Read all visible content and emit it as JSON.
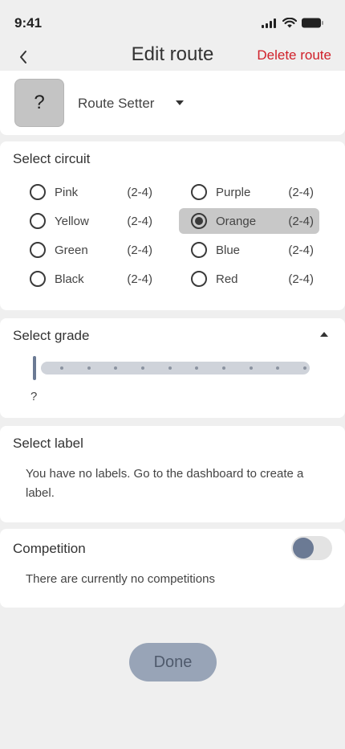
{
  "status_bar": {
    "time": "9:41"
  },
  "nav": {
    "title": "Edit route",
    "delete_label": "Delete route"
  },
  "setter": {
    "avatar_text": "?",
    "name": "Route Setter"
  },
  "circuit": {
    "title": "Select circuit",
    "options": [
      {
        "label": "Pink",
        "count": "(2-4)",
        "selected": false
      },
      {
        "label": "Purple",
        "count": "(2-4)",
        "selected": false
      },
      {
        "label": "Yellow",
        "count": "(2-4)",
        "selected": false
      },
      {
        "label": "Orange",
        "count": "(2-4)",
        "selected": true
      },
      {
        "label": "Green",
        "count": "(2-4)",
        "selected": false
      },
      {
        "label": "Blue",
        "count": "(2-4)",
        "selected": false
      },
      {
        "label": "Black",
        "count": "(2-4)",
        "selected": false
      },
      {
        "label": "Red",
        "count": "(2-4)",
        "selected": false
      }
    ]
  },
  "grade": {
    "title": "Select grade",
    "value": "?",
    "slider_fraction": 0
  },
  "label": {
    "title": "Select label",
    "empty_text": "You have no labels. Go to the dashboard to create a label."
  },
  "competition": {
    "title": "Competition",
    "toggle_on": false,
    "empty_text": "There are currently no competitions"
  },
  "done_label": "Done",
  "colors": {
    "delete": "#d0202a",
    "accent": "#6b7a94",
    "done_bg": "#98a4b7"
  }
}
